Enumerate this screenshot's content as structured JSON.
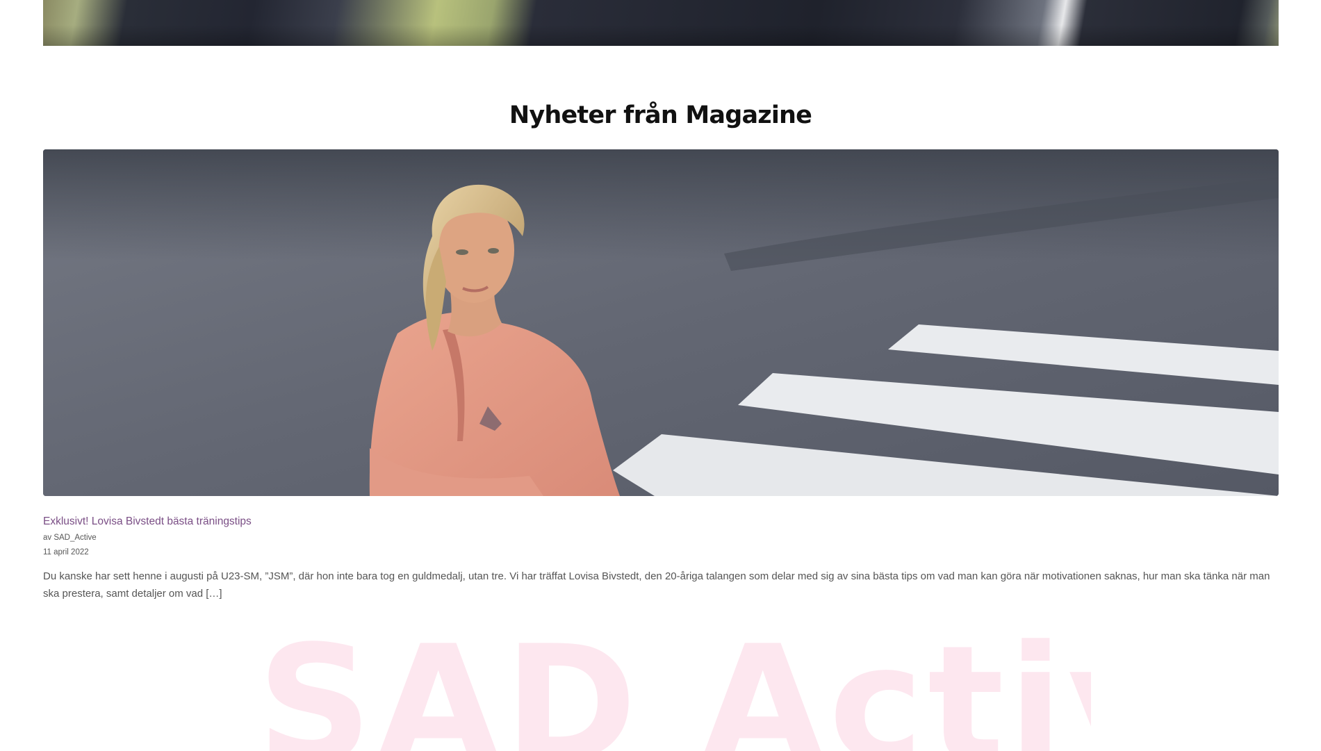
{
  "section": {
    "title": "Nyheter från Magazine"
  },
  "post": {
    "title": "Exklusivt! Lovisa Bivstedt bästa träningstips",
    "author": "av SAD_Active",
    "date": "11 april 2022",
    "excerpt": "Du kanske har sett henne i augusti på U23-SM, ”JSM”, där hon inte bara tog en guldmedalj, utan tre. Vi har träffat Lovisa Bivstedt, den 20-åriga talangen som delar med sig av sina bästa tips om vad man kan göra när motivationen saknas, hur man ska tänka när man ska prestera, samt detaljer om vad […]"
  },
  "footer": {
    "watermark": "SAD Active"
  },
  "colors": {
    "link": "#7a4e85",
    "watermark": "#fde7ef"
  }
}
